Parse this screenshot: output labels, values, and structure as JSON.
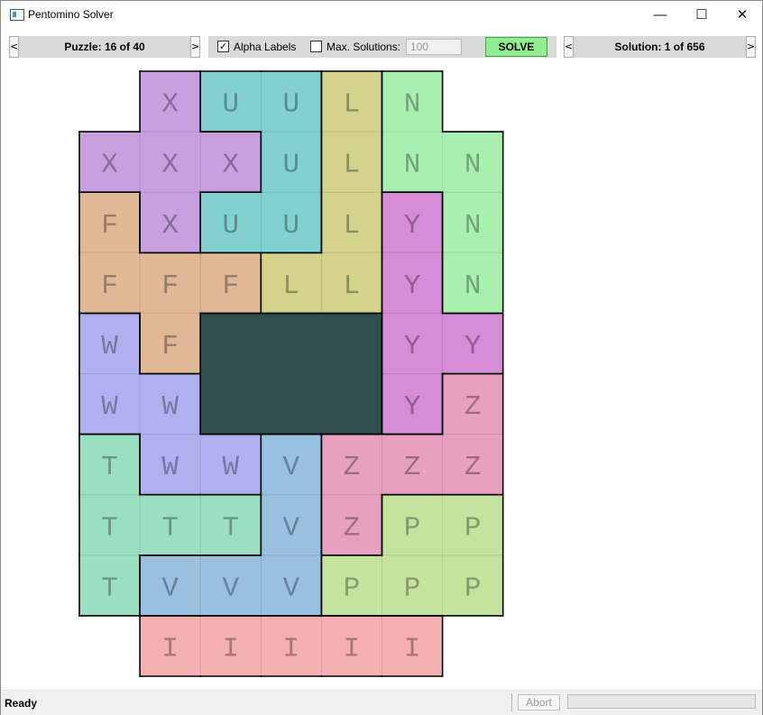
{
  "window": {
    "title": "Pentomino Solver",
    "controls": [
      "—",
      "☐",
      "✕"
    ]
  },
  "puzzle_nav": {
    "prev": "<",
    "label": "Puzzle: 16 of 40",
    "next": ">"
  },
  "options": {
    "alpha_labels": {
      "label": "Alpha Labels",
      "checked": true,
      "mark": "✓"
    },
    "max_solutions": {
      "label": "Max. Solutions:",
      "checked": false,
      "value": "100"
    },
    "solve_label": "SOLVE"
  },
  "solution_nav": {
    "prev": "<",
    "label": "Solution: 1 of 656",
    "next": ">"
  },
  "board": {
    "rows": [
      ".XUULN.",
      "XXXULNN",
      "FXUULYN",
      "FFFLLYN",
      "WF###YY",
      "WW###YZ",
      "TWWVZZZ",
      "TTTVZPP",
      "TVVVPPP",
      ".IIIII."
    ],
    "colors": {
      "X": "#c8a0e0",
      "U": "#82d0d0",
      "L": "#d3d38c",
      "N": "#a8f0b0",
      "F": "#e0b896",
      "Y": "#d68cd6",
      "W": "#b0b0f0",
      "Z": "#e8a0c0",
      "T": "#9ae0c0",
      "V": "#9ac0e0",
      "P": "#c4e49e",
      "I": "#f4b0b0",
      "hole": "#2f4f4f"
    }
  },
  "status": {
    "text": "Ready",
    "abort_label": "Abort"
  }
}
